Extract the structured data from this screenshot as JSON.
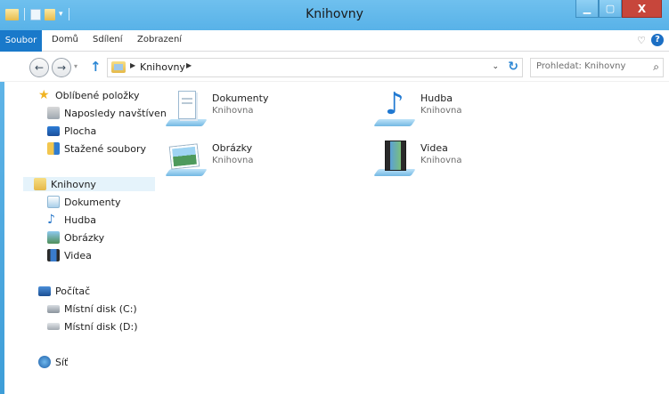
{
  "window": {
    "title": "Knihovny"
  },
  "ribbon": {
    "tabs": [
      "Soubor",
      "Domů",
      "Sdílení",
      "Zobrazení"
    ]
  },
  "address_bar": {
    "path": "Knihovny",
    "search_placeholder": "Prohledat: Knihovny"
  },
  "nav": {
    "favorites": {
      "label": "Oblíbené položky",
      "items": [
        "Naposledy navštíven",
        "Plocha",
        "Stažené soubory"
      ]
    },
    "libraries": {
      "label": "Knihovny",
      "items": [
        "Dokumenty",
        "Hudba",
        "Obrázky",
        "Videa"
      ]
    },
    "computer": {
      "label": "Počítač",
      "items": [
        "Místní disk (C:)",
        "Místní disk (D:)"
      ]
    },
    "network": {
      "label": "Síť"
    }
  },
  "content": {
    "libraries": [
      {
        "name": "Dokumenty",
        "type": "Knihovna",
        "icon": "documents-library-icon"
      },
      {
        "name": "Hudba",
        "type": "Knihovna",
        "icon": "music-library-icon"
      },
      {
        "name": "Obrázky",
        "type": "Knihovna",
        "icon": "pictures-library-icon"
      },
      {
        "name": "Videa",
        "type": "Knihovna",
        "icon": "videos-library-icon"
      }
    ]
  },
  "colors": {
    "titlebar": "#58b2e8",
    "file_tab": "#1979ca",
    "close_button": "#c7463b",
    "selection": "#e5f3fb"
  }
}
